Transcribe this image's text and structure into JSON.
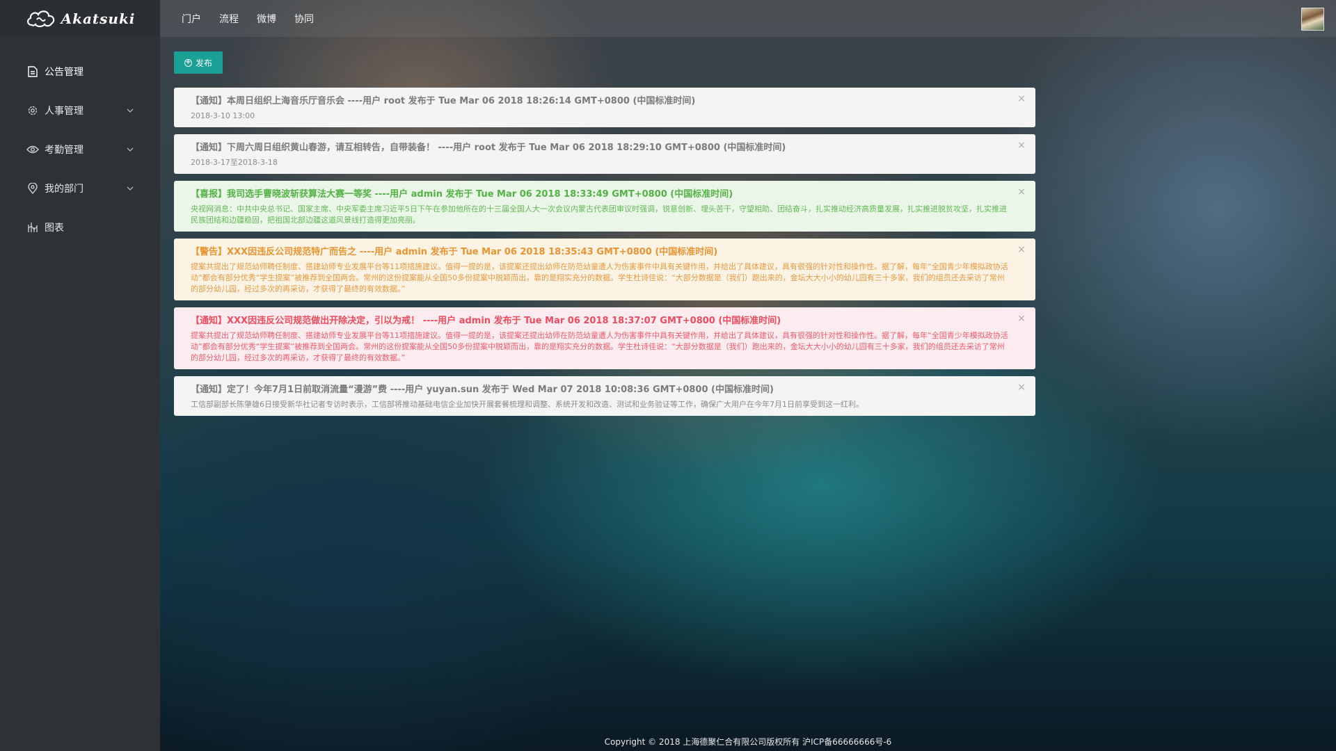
{
  "app": {
    "logo_text": "Akatsuki"
  },
  "sidebar": {
    "items": [
      {
        "label": "公告管理",
        "icon": "document-icon",
        "expandable": false
      },
      {
        "label": "人事管理",
        "icon": "gear-icon",
        "expandable": true
      },
      {
        "label": "考勤管理",
        "icon": "eye-icon",
        "expandable": true
      },
      {
        "label": "我的部门",
        "icon": "location-icon",
        "expandable": true
      },
      {
        "label": "图表",
        "icon": "chart-icon",
        "expandable": false
      }
    ]
  },
  "topnav": {
    "items": [
      "门户",
      "流程",
      "微博",
      "协同"
    ]
  },
  "toolbar": {
    "publish_label": "发布"
  },
  "notices": [
    {
      "type": "info",
      "title": "【通知】本周日组织上海音乐厅音乐会 ----用户 root 发布于 Tue Mar 06 2018 18:26:14 GMT+0800 (中国标准时间)",
      "body": "2018-3-10 13:00"
    },
    {
      "type": "info",
      "title": "【通知】下周六周日组织黄山春游，请互相转告，自带装备！ ----用户 root 发布于 Tue Mar 06 2018 18:29:10 GMT+0800 (中国标准时间)",
      "body": "2018-3-17至2018-3-18"
    },
    {
      "type": "success",
      "title": "【喜报】我司选手曹晓波斩获算法大赛一等奖 ----用户 admin 发布于 Tue Mar 06 2018 18:33:49 GMT+0800 (中国标准时间)",
      "body": "央视网消息：中共中央总书记、国家主席、中央军委主席习近平5日下午在参加他所在的十三届全国人大一次会议内蒙古代表团审议时强调，锐意创新、埋头苦干，守望相助、团结奋斗，扎实推动经济高质量发展，扎实推进脱贫攻坚，扎实推进民族团结和边疆稳固，把祖国北部边疆这道风景线打造得更加亮丽。"
    },
    {
      "type": "warning",
      "title": "【警告】XXX因违反公司规范特广而告之 ----用户 admin 发布于 Tue Mar 06 2018 18:35:43 GMT+0800 (中国标准时间)",
      "body": "提案共提出了规范幼师聘任制度、搭建幼师专业发展平台等11项措施建议。值得一提的是，该提案还提出幼师在防范幼童遭人为伤害事件中具有关键作用，并给出了具体建议，具有很强的针对性和操作性。据了解，每年“全国青少年模拟政协活动”都会有部分优秀“学生提案”被推荐到全国两会。常州的这份提案能从全国50多份提案中脱颖而出，靠的是翔实充分的数据。学生杜诗佳说：“大部分数据是（我们）跑出来的，金坛大大小小的幼儿园有三十多家，我们的组员还去采访了常州的部分幼儿园，经过多次的再采访，才获得了最终的有效数据。”"
    },
    {
      "type": "danger",
      "title": "【通知】XXX因违反公司规范做出开除决定，引以为戒！ ----用户 admin 发布于 Tue Mar 06 2018 18:37:07 GMT+0800 (中国标准时间)",
      "body": "提案共提出了规范幼师聘任制度、搭建幼师专业发展平台等11项措施建议。值得一提的是，该提案还提出幼师在防范幼童遭人为伤害事件中具有关键作用，并给出了具体建议，具有很强的针对性和操作性。据了解，每年“全国青少年模拟政协活动”都会有部分优秀“学生提案”被推荐到全国两会。常州的这份提案能从全国50多份提案中脱颖而出，靠的是翔实充分的数据。学生杜诗佳说：“大部分数据是（我们）跑出来的，金坛大大小小的幼儿园有三十多家，我们的组员还去采访了常州的部分幼儿园，经过多次的再采访，才获得了最终的有效数据。”"
    },
    {
      "type": "info",
      "title": "【通知】定了！今年7月1日前取消流量“漫游”费 ----用户 yuyan.sun 发布于 Wed Mar 07 2018 10:08:36 GMT+0800 (中国标准时间)",
      "body": "工信部副部长陈肇雄6日接受新华社记者专访时表示，工信部将推动基础电信企业加快开展套餐梳理和调整、系统开发和改造、测试和业务验证等工作，确保广大用户在今年7月1日前享受到这一红利。"
    }
  ],
  "close_glyph": "×",
  "footer": {
    "text": "Copyright © 2018 上海德聚仁合有限公司版权所有 沪ICP备66666666号-6"
  },
  "colors": {
    "sidebar_bg": "#2e3236",
    "accent": "#1aa094",
    "info": "#7b7b7b",
    "success": "#53b245",
    "warning": "#e9942f",
    "danger": "#ec4c5e"
  }
}
